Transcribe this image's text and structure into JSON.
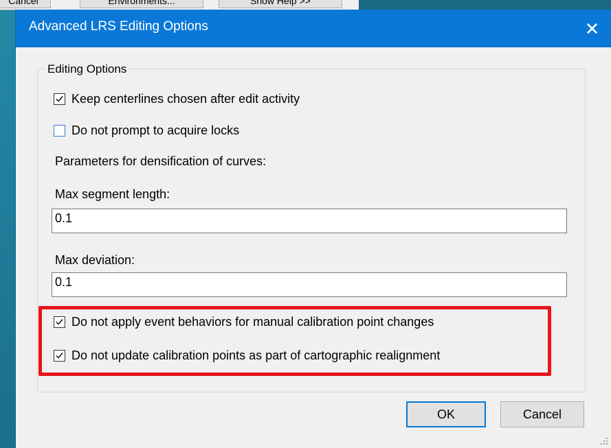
{
  "background": {
    "buttons": [
      "Cancel",
      "Environments...",
      "Show Help >>"
    ]
  },
  "dialog": {
    "title": "Advanced LRS Editing Options",
    "close_glyph": "✕",
    "group_title": "Editing Options",
    "options": {
      "keep_centerlines": {
        "label": "Keep centerlines chosen after edit activity",
        "checked": true
      },
      "no_prompt_locks": {
        "label": "Do not prompt to acquire locks",
        "checked": false
      }
    },
    "densification_label": "Parameters for densification of curves:",
    "max_segment_length": {
      "label": "Max segment length:",
      "value": "0.1"
    },
    "max_deviation": {
      "label": "Max deviation:",
      "value": "0.1"
    },
    "highlighted_options": {
      "no_event_behaviors": {
        "label": "Do not apply event behaviors for manual calibration point changes",
        "checked": true
      },
      "no_update_calibration": {
        "label": "Do not update calibration points as part of cartographic realignment",
        "checked": true
      }
    },
    "buttons": {
      "ok": "OK",
      "cancel": "Cancel"
    }
  },
  "colors": {
    "titlebar": "#0a78d7",
    "highlight": "#e8141c",
    "dialog_bg": "#f0f0f0"
  }
}
